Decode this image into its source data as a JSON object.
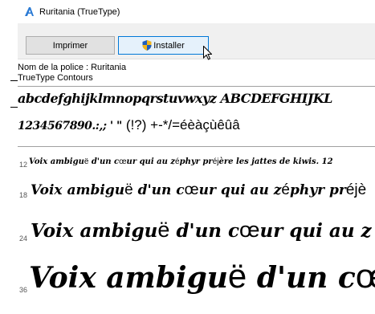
{
  "window": {
    "title": "Ruritania (TrueType)"
  },
  "toolbar": {
    "print_label": "Imprimer",
    "install_label": "Installer"
  },
  "info": {
    "font_name_line": "Nom de la police : Ruritania",
    "font_type_line": "TrueType  Contours"
  },
  "glyphs": {
    "lowercase_row": "abcdefghijklmnopqrstuvwxyz ABCDEFGHIJKL",
    "digits_prefix": "1234567890.:,; ' \"",
    "digits_suffix": "(!?) +-*/=éèàçùêûâ"
  },
  "samples": [
    {
      "size": "12",
      "bl1": "Voix ambigu",
      "pl1": "ë",
      "bl2": " d'un c",
      "pl2": "œ",
      "bl3": "ur qui au z",
      "pl3": "é",
      "bl4": "phyr pr",
      "pl4": "éj",
      "bl5": "ère les jattes de kiwis. 12"
    },
    {
      "size": "18",
      "bl1": "Voix ambigu",
      "pl1": "ë",
      "bl2": " d'un c",
      "pl2": "œ",
      "bl3": "ur qui au z",
      "pl3": "é",
      "bl4": "phyr pr",
      "pl4": "éjè",
      "bl5": ""
    },
    {
      "size": "24",
      "bl1": "Voix ambigu",
      "pl1": "ë",
      "bl2": " d'un c",
      "pl2": "œ",
      "bl3": "ur qui au z",
      "pl3": "",
      "bl4": "",
      "pl4": "",
      "bl5": ""
    },
    {
      "size": "36",
      "bl1": "Voix ambigu",
      "pl1": "ë",
      "bl2": " d'un c",
      "pl2": "œ",
      "bl3": "",
      "pl3": "",
      "bl4": "",
      "pl4": "",
      "bl5": ""
    }
  ]
}
